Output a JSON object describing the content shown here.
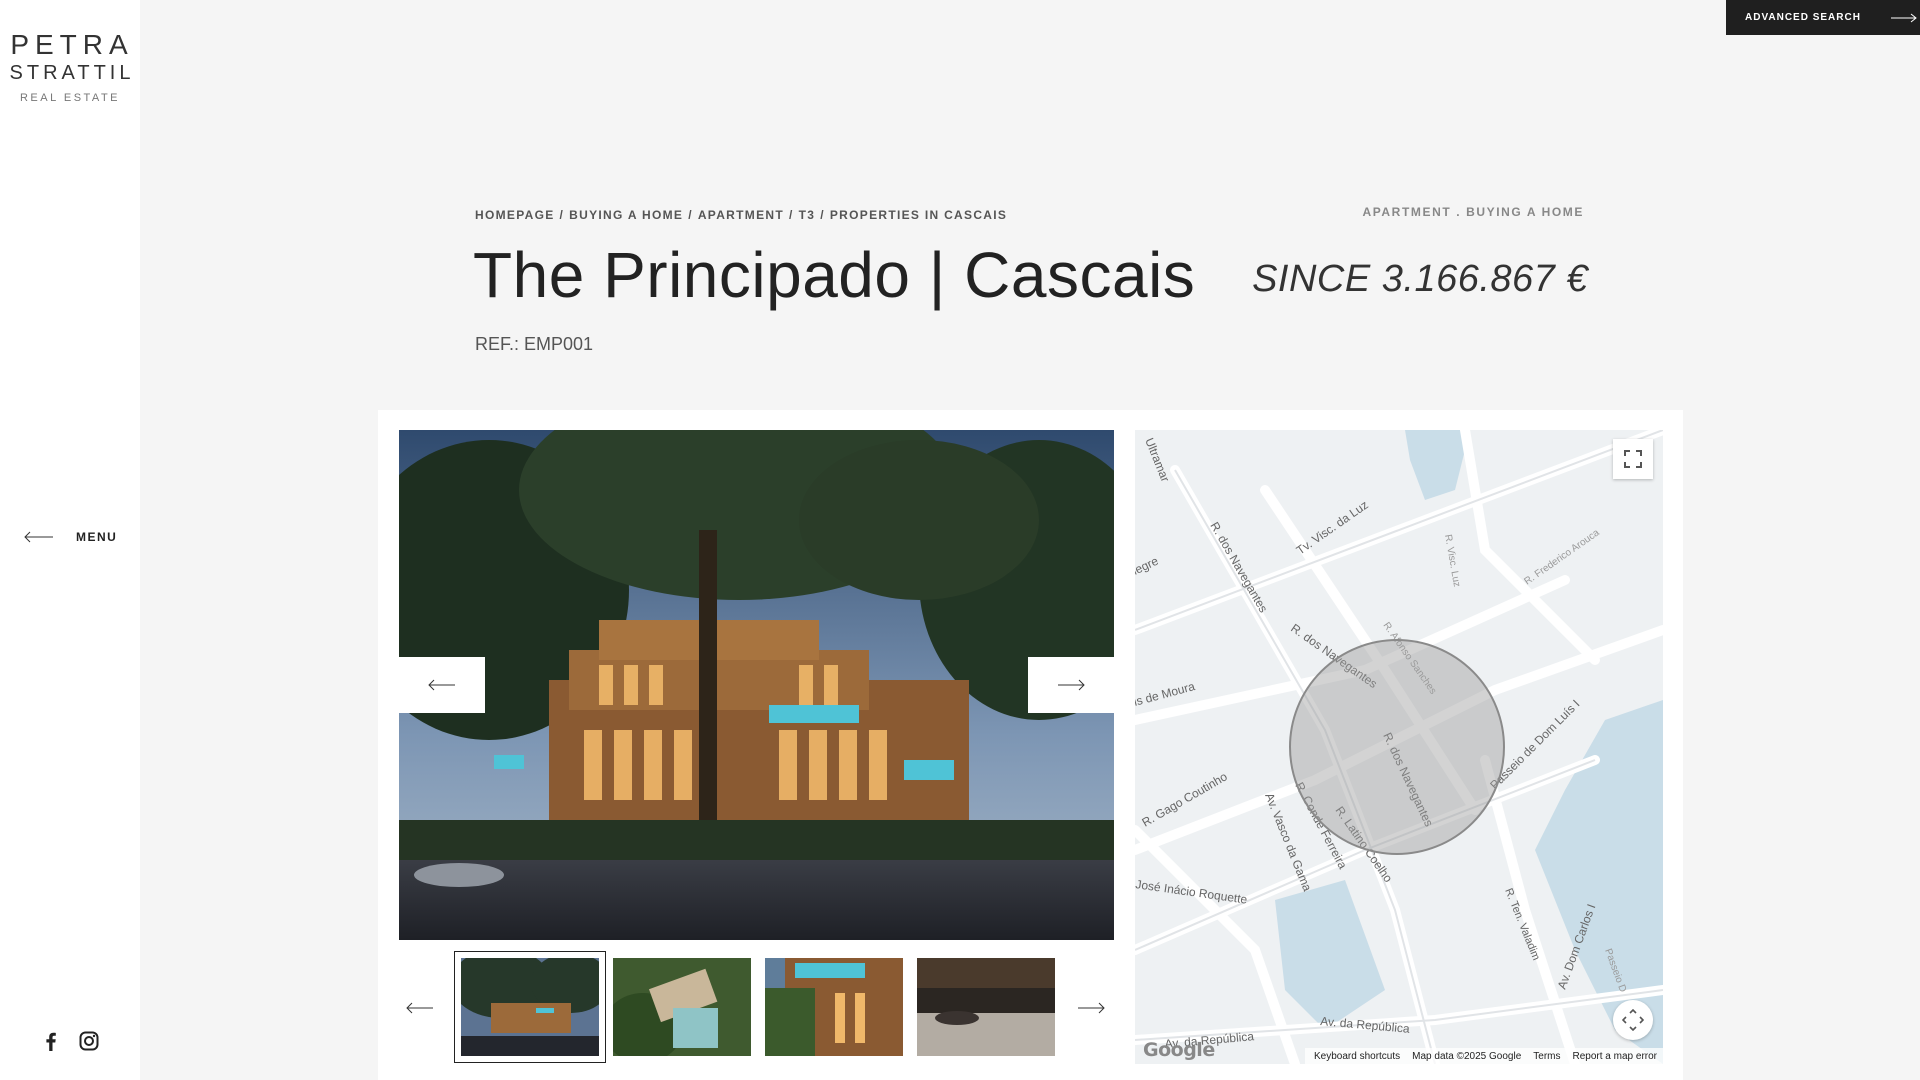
{
  "logo": {
    "line1": "PETRA",
    "line2": "STRATTIL",
    "line3": "REAL ESTATE"
  },
  "sidebar": {
    "menu_label": "MENU",
    "social": [
      "facebook-icon",
      "instagram-icon"
    ]
  },
  "advanced_search": {
    "label": "ADVANCED SEARCH"
  },
  "breadcrumb": [
    "HOMEPAGE",
    "BUYING A HOME",
    "APARTMENT",
    "T3",
    "PROPERTIES IN CASCAIS"
  ],
  "breadcrumb_separator": "/",
  "categories": "APARTMENT . BUYING A HOME",
  "listing": {
    "title": "The Principado | Cascais",
    "price": "SINCE 3.166.867 €",
    "ref": "REF.: EMP001"
  },
  "gallery": {
    "thumbnail_count": 4,
    "active_index": 0
  },
  "map": {
    "streets": [
      "Ultramar",
      "R. dos Navegantes",
      "Tv. Visc. da Luz",
      "R. Visc. Luz",
      "R. Frederico Arouca",
      "legre",
      "R. dos Navegantes",
      "R. Afonso Sanches",
      "is de Moura",
      "R. dos Navegantes",
      "Passeio de Dom Luís I",
      "R. Gago Coutinho",
      "R. Conde Ferreira",
      "Av. Vasco da Gama",
      "R. Latino Coelho",
      "José Inácio Roquette",
      "R. Ten. Valadim",
      "Av. Dom Carlos I",
      "Passeio D",
      "Av. da República",
      "Av. da República"
    ],
    "footer": {
      "shortcuts": "Keyboard shortcuts",
      "map_data": "Map data ©2025 Google",
      "terms": "Terms",
      "report": "Report a map error"
    },
    "logo": "Google",
    "colors": {
      "land": "#eef1f3",
      "water": "#c9dde8",
      "road": "#ffffff",
      "circle": "#9e9e9e"
    }
  }
}
